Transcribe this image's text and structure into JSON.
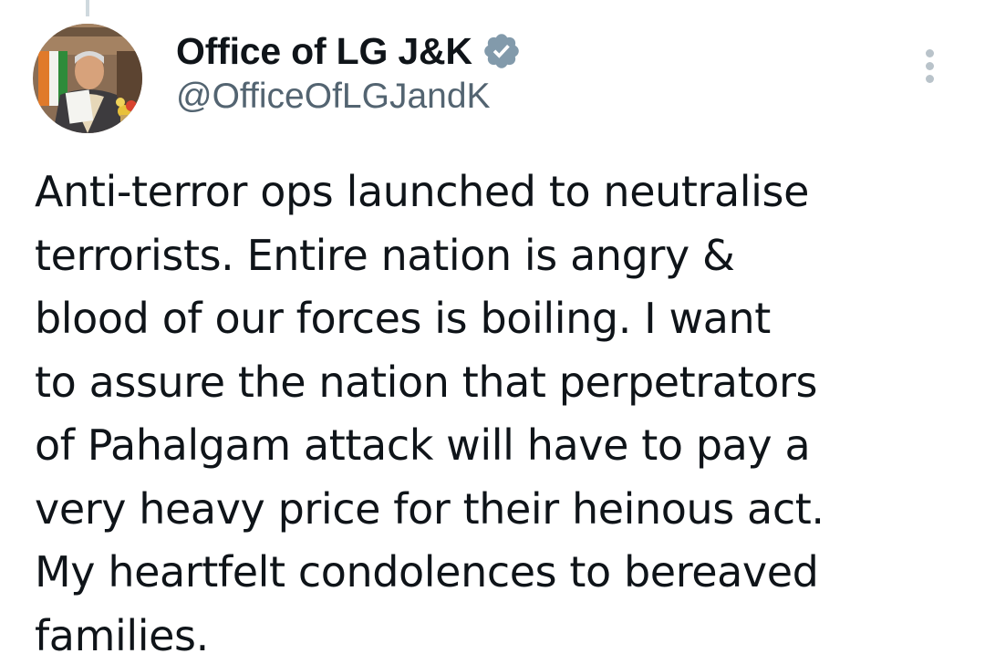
{
  "tweet": {
    "author": {
      "display_name": "Office of LG J&K",
      "handle": "@OfficeOfLGJandK",
      "verified_icon": "verified-badge-icon",
      "avatar_icon": "profile-avatar"
    },
    "more_icon": "more-options-icon",
    "text_lines": [
      "Anti-terror ops launched to neutralise",
      "terrorists. Entire nation is angry &",
      "blood of our forces is boiling. I want",
      "to assure the nation that perpetrators",
      "of Pahalgam attack will have to pay a",
      "very heavy price for their heinous act.",
      "My heartfelt condolences to bereaved",
      "families."
    ]
  },
  "colors": {
    "text_primary": "#0f1419",
    "text_secondary": "#536471",
    "verified_badge": "#829aab",
    "thread_line": "#cfd9de"
  }
}
